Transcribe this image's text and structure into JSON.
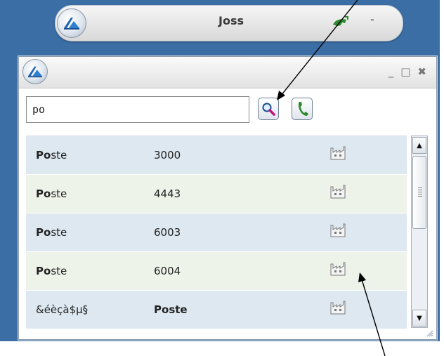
{
  "minibar": {
    "contact_name": "Joss",
    "dash": "-"
  },
  "window": {
    "minimize": "_",
    "maximize": "□",
    "close": "✖"
  },
  "search": {
    "value": "po"
  },
  "icons": {
    "logo": "app-logo-icon",
    "phone": "phone-icon",
    "search": "magnifier-icon",
    "company": "factory-icon"
  },
  "results": [
    {
      "name_bold": "Po",
      "name_rest": "ste",
      "number": "3000"
    },
    {
      "name_bold": "Po",
      "name_rest": "ste",
      "number": "4443"
    },
    {
      "name_bold": "Po",
      "name_rest": "ste",
      "number": "6003"
    },
    {
      "name_bold": "Po",
      "name_rest": "ste",
      "number": "6004"
    },
    {
      "first": "&éèçà$µ§",
      "second_bold": "Po",
      "second_rest": "ste"
    }
  ],
  "scrollbar": {
    "up": "▲",
    "down": "▼"
  }
}
